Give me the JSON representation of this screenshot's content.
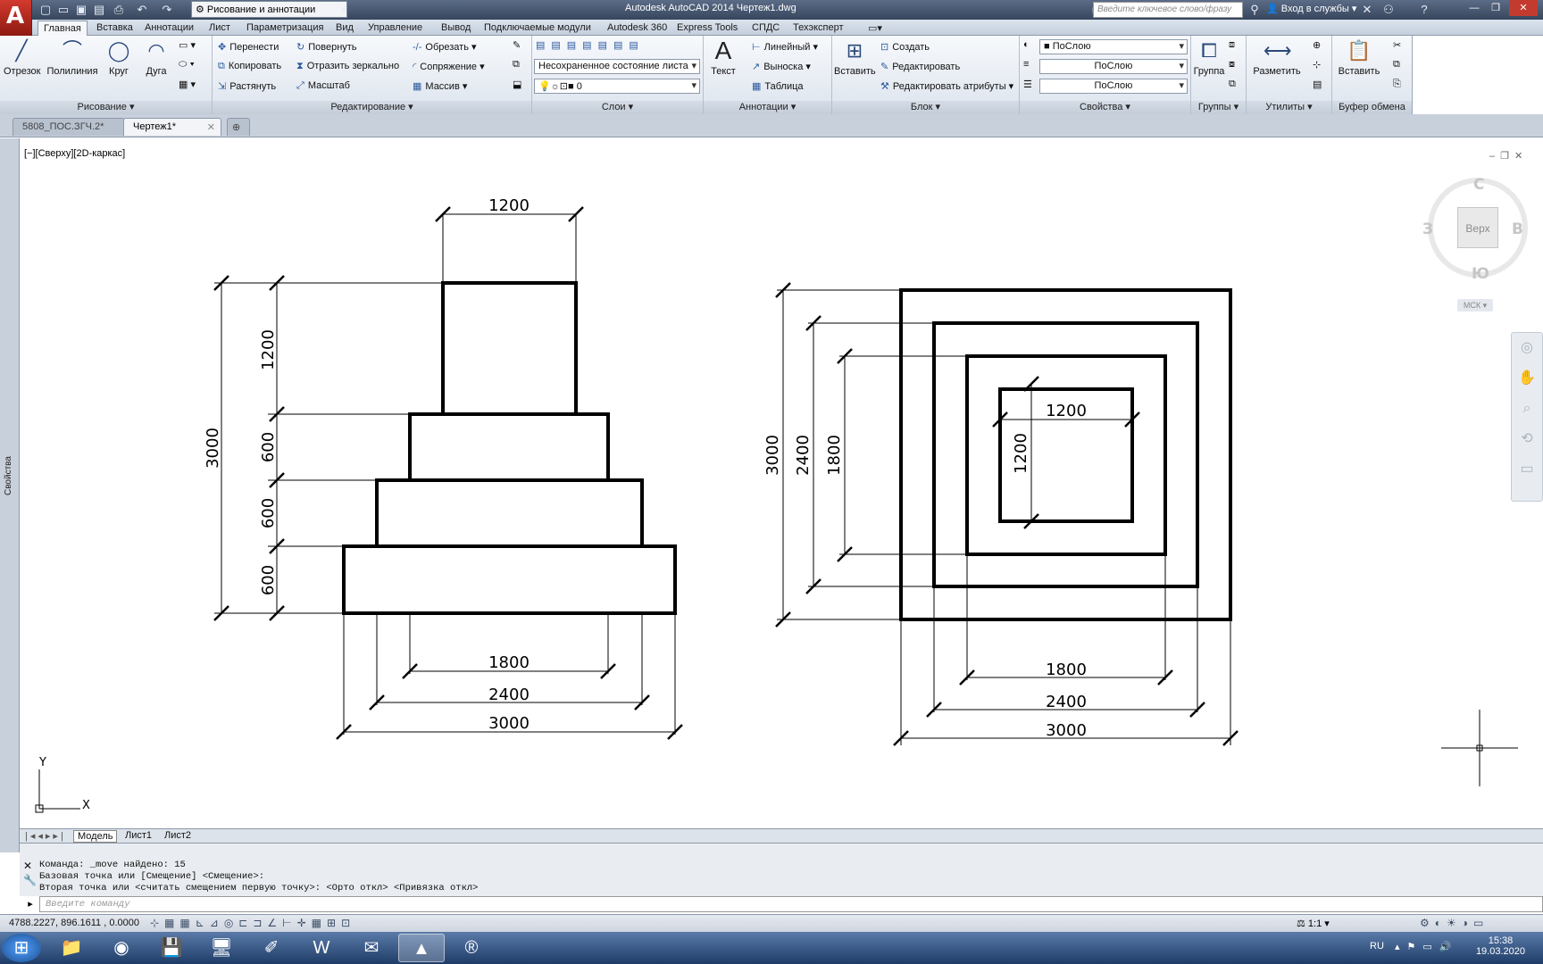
{
  "titlebar": {
    "app_title": "Autodesk AutoCAD 2014    Чертеж1.dwg",
    "workspace": "Рисование и аннотации",
    "search_placeholder": "Введите ключевое слово/фразу",
    "login": "Вход в службы"
  },
  "ribbon_tabs": [
    "Главная",
    "Вставка",
    "Аннотации",
    "Лист",
    "Параметризация",
    "Вид",
    "Управление",
    "Вывод",
    "Подключаемые модули",
    "Autodesk 360",
    "Express Tools",
    "СПДС",
    "Техэксперт"
  ],
  "ribbon": {
    "draw": {
      "title": "Рисование",
      "line": "Отрезок",
      "polyline": "Полилиния",
      "circle": "Круг",
      "arc": "Дуга"
    },
    "modify": {
      "title": "Редактирование",
      "move": "Перенести",
      "rotate": "Повернуть",
      "trim": "Обрезать",
      "copy": "Копировать",
      "mirror": "Отразить зеркально",
      "fillet": "Сопряжение",
      "stretch": "Растянуть",
      "scale": "Масштаб",
      "array": "Массив"
    },
    "layers": {
      "title": "Слои",
      "state": "Несохраненное состояние листа",
      "layer": "0"
    },
    "annotation": {
      "title": "Аннотации",
      "text": "Текст",
      "linear": "Линейный",
      "leader": "Выноска",
      "table": "Таблица"
    },
    "block": {
      "title": "Блок",
      "insert": "Вставить",
      "create": "Создать",
      "edit": "Редактировать",
      "edit_attr": "Редактировать атрибуты"
    },
    "properties": {
      "title": "Свойства",
      "color": "ПоСлою",
      "lineweight": "ПоСлою",
      "linetype": "ПоСлою"
    },
    "groups": {
      "title": "Группы",
      "group": "Группа"
    },
    "utilities": {
      "title": "Утилиты",
      "measure": "Разметить"
    },
    "clipboard": {
      "title": "Буфер обмена",
      "paste": "Вставить"
    }
  },
  "doc_tabs": [
    "5808_ПОС.ЗГЧ.2*",
    "Чертеж1*"
  ],
  "viewport_label": "[−][Сверху][2D-каркас]",
  "viewcube": {
    "top": "Верх",
    "n": "С",
    "s": "Ю",
    "w": "З",
    "e": "В",
    "ucs": "МСК"
  },
  "drawing": {
    "front_dims": {
      "top_w": "1200",
      "h1": "1200",
      "h2": "600",
      "h3": "600",
      "h4": "600",
      "total_h": "3000",
      "w1": "1800",
      "w2": "2400",
      "w3": "3000"
    },
    "plan_dims": {
      "inner_w": "1200",
      "inner_h": "1200",
      "h1": "1800",
      "h2": "2400",
      "h3": "3000",
      "w1": "1800",
      "w2": "2400",
      "w3": "3000"
    },
    "ucs_x": "X",
    "ucs_y": "Y"
  },
  "layout_tabs": [
    "Модель",
    "Лист1",
    "Лист2"
  ],
  "command_history": [
    "Команда: _move найдено: 15",
    "Базовая точка или [Смещение] <Смещение>:",
    "Вторая точка или <считать смещением первую точку>:  <Орто откл>  <Привязка откл>"
  ],
  "command_placeholder": "Введите команду",
  "status": {
    "coords": "4788.2227, 896.1611 , 0.0000",
    "scale": "1:1"
  },
  "taskbar": {
    "lang": "RU",
    "time": "15:38",
    "date": "19.03.2020"
  },
  "side_panel": "Свойства"
}
